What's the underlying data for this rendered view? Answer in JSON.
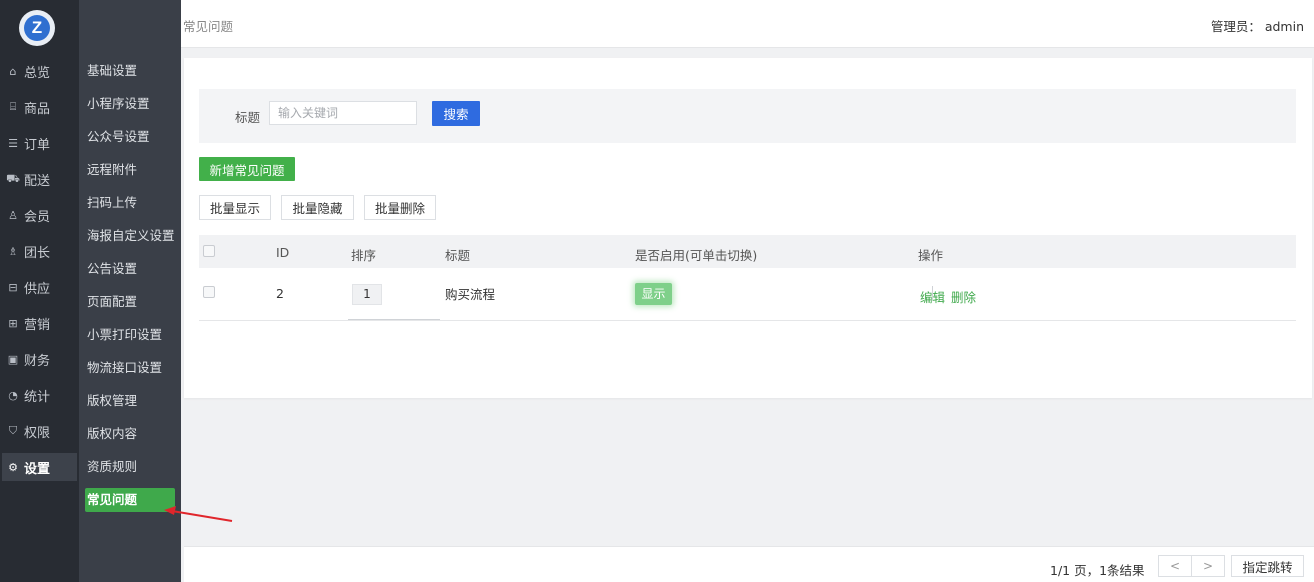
{
  "rail": {
    "items": [
      {
        "label": "总览",
        "icon": "home-icon"
      },
      {
        "label": "商品",
        "icon": "shop-icon"
      },
      {
        "label": "订单",
        "icon": "order-icon"
      },
      {
        "label": "配送",
        "icon": "delivery-icon"
      },
      {
        "label": "会员",
        "icon": "user-icon"
      },
      {
        "label": "团长",
        "icon": "leader-icon"
      },
      {
        "label": "供应",
        "icon": "supply-icon"
      },
      {
        "label": "营销",
        "icon": "gift-icon"
      },
      {
        "label": "财务",
        "icon": "finance-icon"
      },
      {
        "label": "统计",
        "icon": "stats-icon"
      },
      {
        "label": "权限",
        "icon": "shield-icon"
      },
      {
        "label": "设置",
        "icon": "gear-icon"
      }
    ],
    "active_index": 11
  },
  "subnav": {
    "items": [
      "基础设置",
      "小程序设置",
      "公众号设置",
      "远程附件",
      "扫码上传",
      "海报自定义设置",
      "公告设置",
      "页面配置",
      "小票打印设置",
      "物流接口设置",
      "版权管理",
      "版权内容",
      "资质规则",
      "常见问题"
    ],
    "active_index": 13
  },
  "header": {
    "breadcrumb": "常见问题",
    "admin": "管理员： admin"
  },
  "search": {
    "label": "标题",
    "placeholder": "输入关键词",
    "value": "",
    "button": "搜索"
  },
  "actions": {
    "add": "新增常见问题",
    "batch_show": "批量显示",
    "batch_hide": "批量隐藏",
    "batch_delete": "批量删除"
  },
  "table": {
    "columns": {
      "id": "ID",
      "sort": "排序",
      "title": "标题",
      "enabled": "是否启用(可单击切换)",
      "ops": "操作"
    },
    "rows": [
      {
        "id": "2",
        "sort": "1",
        "title": "购买流程",
        "status": "显示",
        "edit": "编辑",
        "delete": "删除"
      }
    ]
  },
  "pagination": {
    "info": "1/1 页，1条结果",
    "prev": "<",
    "next": ">",
    "jump": "指定跳转"
  },
  "colors": {
    "sidebar_dark": "#282c33",
    "sidebar_mid": "#3a3f48",
    "accent_green": "#42b04a",
    "accent_blue": "#2f6be0",
    "arrow_red": "#e0262b"
  }
}
